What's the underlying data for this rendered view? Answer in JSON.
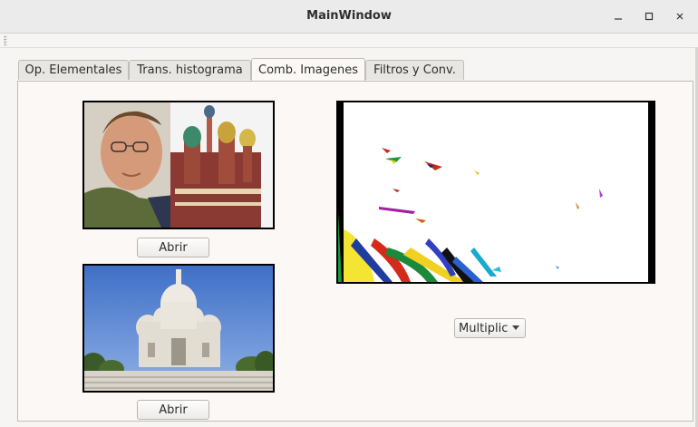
{
  "window": {
    "title": "MainWindow",
    "minimize_icon": "minimize-icon",
    "maximize_icon": "maximize-icon",
    "close_icon": "close-icon"
  },
  "tabs": [
    {
      "label": "Op. Elementales",
      "active": false
    },
    {
      "label": "Trans. histograma",
      "active": false
    },
    {
      "label": "Comb. Imagenes",
      "active": true
    },
    {
      "label": "Filtros y Conv.",
      "active": false
    }
  ],
  "image1": {
    "open_label": "Abrir"
  },
  "image2": {
    "open_label": "Abrir"
  },
  "operation": {
    "selected": "Multiplicar"
  }
}
